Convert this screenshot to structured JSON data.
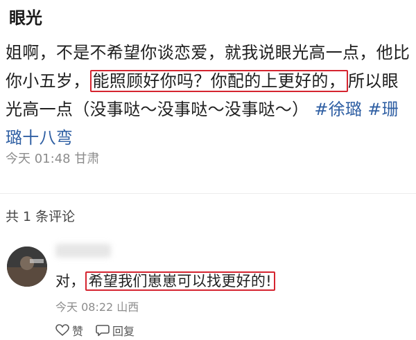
{
  "post": {
    "title": "眼光",
    "body_pre": "姐啊，不是不希望你谈恋爱，就我说眼光高一点，他比你小五岁，",
    "body_highlight": "能照顾好你吗？你配的上更好的，",
    "body_post": "所以眼光高一点（没事哒～没事哒～没事哒～）",
    "tags": [
      "#徐璐",
      "#珊璐十八弯"
    ],
    "time": "今天 01:48",
    "location": "甘肃"
  },
  "comments_section": {
    "count_label": "共 1 条评论"
  },
  "comment": {
    "prefix": "对，",
    "highlight": "希望我们崽崽可以找更好的!",
    "time": "今天 08:22",
    "location": "山西",
    "like_label": "赞",
    "reply_label": "回复"
  },
  "colors": {
    "highlight_border": "#d5242f",
    "tag": "#2f5fa3",
    "meta": "#8c8c8c"
  },
  "icons": {
    "like": "heart-icon",
    "reply": "comment-bubble-icon"
  }
}
